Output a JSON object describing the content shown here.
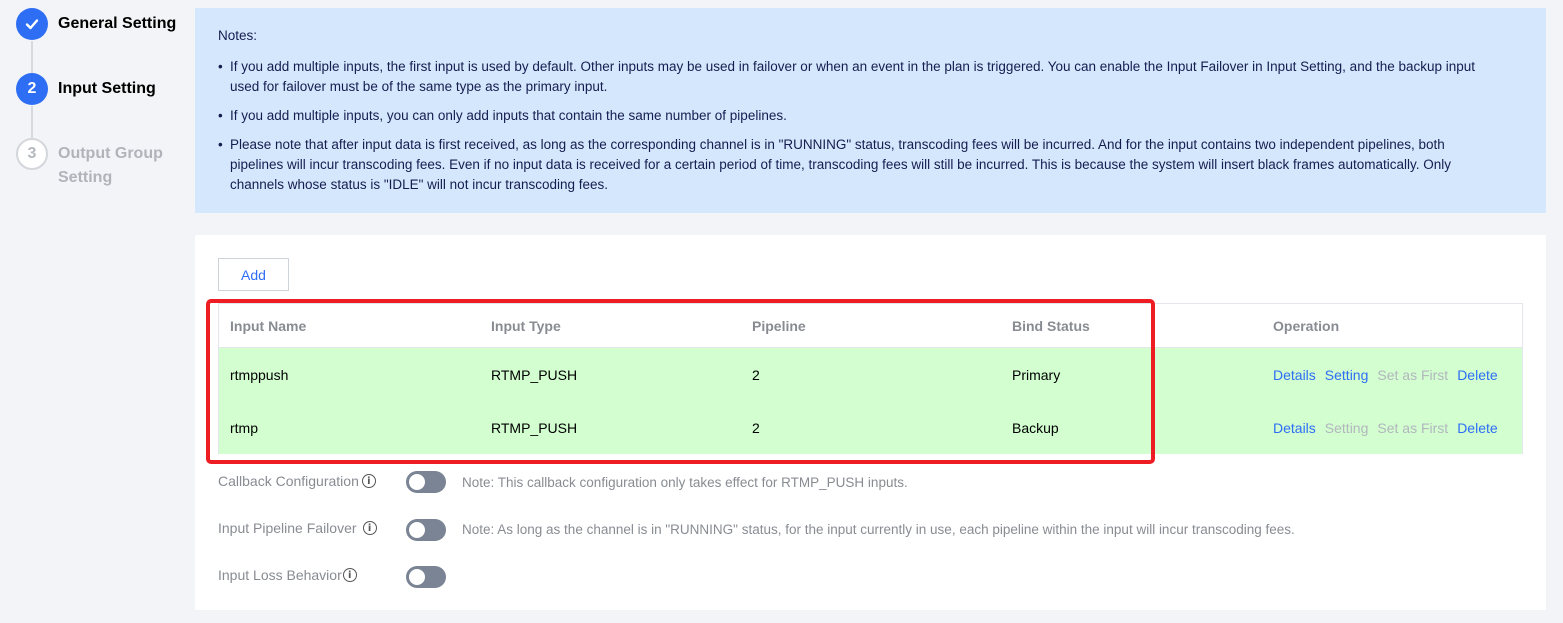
{
  "stepper": {
    "steps": [
      {
        "number": "✓",
        "label": "General Setting",
        "state": "done"
      },
      {
        "number": "2",
        "label": "Input Setting",
        "state": "active"
      },
      {
        "number": "3",
        "label": "Output Group Setting",
        "state": "pending"
      }
    ]
  },
  "notes": {
    "title": "Notes:",
    "items": [
      "If you add multiple inputs, the first input is used by default. Other inputs may be used in failover or when an event in the plan is triggered. You can enable the Input Failover in Input Setting, and the backup input used for failover must be of the same type as the primary input.",
      "If you add multiple inputs, you can only add inputs that contain the same number of pipelines.",
      "Please note that after input data is first received, as long as the corresponding channel is in \"RUNNING\" status, transcoding fees will be incurred. And for the input contains two independent pipelines, both pipelines will incur transcoding fees. Even if no input data is received for a certain period of time, transcoding fees will still be incurred. This is because the system will insert black frames automatically. Only channels whose status is \"IDLE\" will not incur transcoding fees."
    ]
  },
  "panel": {
    "add_label": "Add",
    "table": {
      "headers": [
        "Input Name",
        "Input Type",
        "Pipeline",
        "Bind Status",
        "Operation"
      ],
      "rows": [
        {
          "name": "rtmppush",
          "type": "RTMP_PUSH",
          "pipeline": "2",
          "bind_status": "Primary",
          "ops": {
            "details": "Details",
            "setting": "Setting",
            "set_first": "Set as First",
            "delete": "Delete"
          }
        },
        {
          "name": "rtmp",
          "type": "RTMP_PUSH",
          "pipeline": "2",
          "bind_status": "Backup",
          "ops": {
            "details": "Details",
            "setting": "Setting",
            "set_first": "Set as First",
            "delete": "Delete"
          }
        }
      ]
    },
    "settings": {
      "callback": {
        "label": "Callback Configuration",
        "note": "Note: This callback configuration only takes effect for RTMP_PUSH inputs."
      },
      "pipeline_failover": {
        "label": "Input Pipeline Failover",
        "note": "Note: As long as the channel is in \"RUNNING\" status, for the input currently in use, each pipeline within the input will incur transcoding fees."
      },
      "loss_behavior": {
        "label": "Input Loss Behavior"
      }
    }
  },
  "colors": {
    "accent": "#2e6ef5",
    "notes_bg": "#d5e7fd",
    "row_highlight": "#d2fed0",
    "annotation_red": "#ee1d23"
  },
  "icons": [
    "check-icon",
    "info-icon"
  ]
}
